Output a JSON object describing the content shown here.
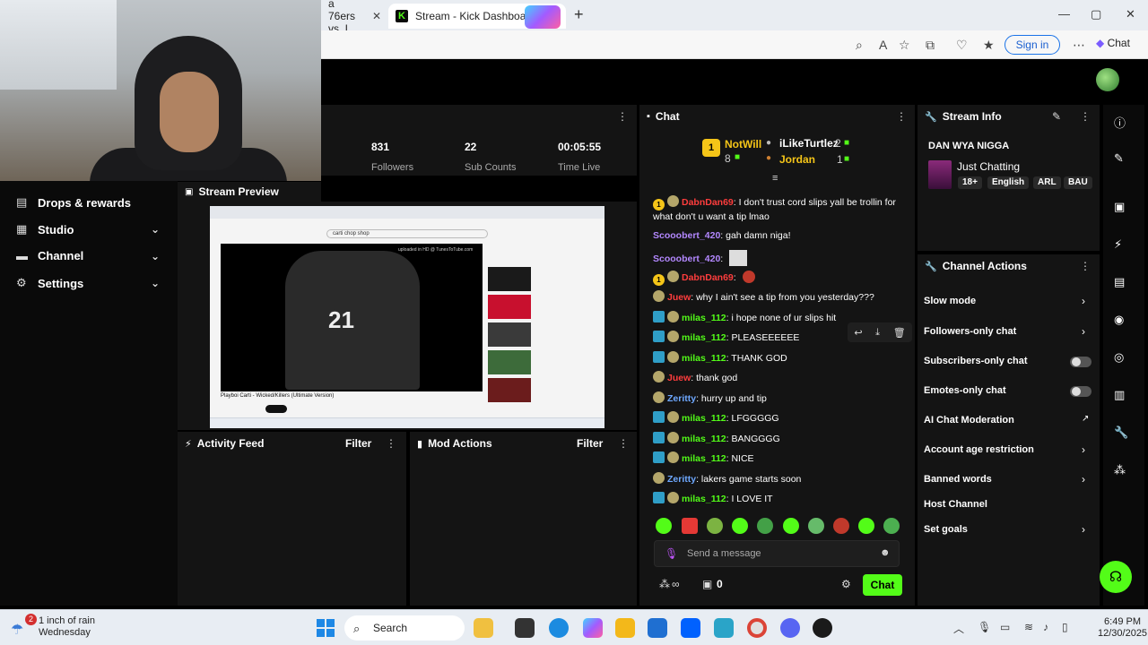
{
  "browser": {
    "tabs": [
      {
        "label": "a 76ers vs. I"
      },
      {
        "label": "Stream - Kick Dashboard"
      }
    ],
    "signin_label": "Sign in",
    "chat_label": "Chat"
  },
  "sidebar": {
    "items": [
      {
        "label": "Drops & rewards",
        "icon": "gift-icon"
      },
      {
        "label": "Studio",
        "icon": "studio-icon"
      },
      {
        "label": "Channel",
        "icon": "channel-icon"
      },
      {
        "label": "Settings",
        "icon": "gear-icon"
      }
    ]
  },
  "stats": [
    {
      "value": "831",
      "label": "Followers"
    },
    {
      "value": "22",
      "label": "Sub Counts"
    },
    {
      "value": "00:05:55",
      "label": "Time Live"
    }
  ],
  "preview": {
    "title": "Stream Preview",
    "screen_search": "carti chop shop",
    "screen_video_title": "Playboi Carti - Wicked/Killers (Ultimate Version)",
    "screen_caption": "uploaded in HD @ TunesToTube.com"
  },
  "activity": {
    "title": "Activity Feed",
    "filter": "Filter"
  },
  "mod_actions": {
    "title": "Mod Actions",
    "filter": "Filter"
  },
  "chat": {
    "title": "Chat",
    "leaderboard": {
      "first": {
        "rank": "1",
        "name": "NotWill",
        "count": "8"
      },
      "second": {
        "name": "iLikeTurtlez",
        "count": "2"
      },
      "third": {
        "name": "Jordan",
        "count": "1"
      }
    },
    "messages": [
      {
        "user": "DabnDan69",
        "text": ": I don't trust cord slips yall be trollin for what don't u want a tip lmao"
      },
      {
        "user": "Scooobert_420",
        "text": ": gah damn niga!"
      },
      {
        "user": "Scooobert_420",
        "text": ":"
      },
      {
        "user": "DabnDan69",
        "text": ":"
      },
      {
        "user": "Juew",
        "text": ": why I ain't see a tip from you yesterday???"
      },
      {
        "user": "milas_112",
        "text": ": i hope none of ur slips hit"
      },
      {
        "user": "milas_112",
        "text": ": PLEASEEEEEE"
      },
      {
        "user": "milas_112",
        "text": ": THANK GOD"
      },
      {
        "user": "Juew",
        "text": ": thank god"
      },
      {
        "user": "Zeritty",
        "text": ": hurry up and tip"
      },
      {
        "user": "milas_112",
        "text": ": LFGGGGG"
      },
      {
        "user": "milas_112",
        "text": ": BANGGGG"
      },
      {
        "user": "milas_112",
        "text": ": NICE"
      },
      {
        "user": "Zeritty",
        "text": ": lakers game starts soon"
      },
      {
        "user": "milas_112",
        "text": ": I LOVE IT"
      }
    ],
    "input_placeholder": "Send a message",
    "points": "0",
    "send_label": "Chat"
  },
  "stream_info": {
    "title": "Stream Info",
    "stream_title": "DAN WYA NIGGA",
    "category": "Just Chatting",
    "tags": [
      "18+",
      "English",
      "ARL",
      "BAU"
    ]
  },
  "channel_actions": {
    "title": "Channel Actions",
    "items": [
      {
        "label": "Slow mode"
      },
      {
        "label": "Followers-only chat"
      },
      {
        "label": "Subscribers-only chat"
      },
      {
        "label": "Emotes-only chat"
      },
      {
        "label": "AI Chat Moderation"
      },
      {
        "label": "Account age restriction"
      },
      {
        "label": "Banned words"
      },
      {
        "label": "Host Channel"
      },
      {
        "label": "Set goals"
      }
    ],
    "toggles": {
      "subscribers_only": false,
      "emotes_only": false
    }
  },
  "taskbar": {
    "weather_badge": "2",
    "weather_line1": "1 inch of rain",
    "weather_line2": "Wednesday",
    "search_label": "Search",
    "time": "6:49 PM",
    "date": "12/30/2025"
  },
  "colors": {
    "accent": "#53fc18",
    "panel": "#141414",
    "background": "#000000"
  }
}
